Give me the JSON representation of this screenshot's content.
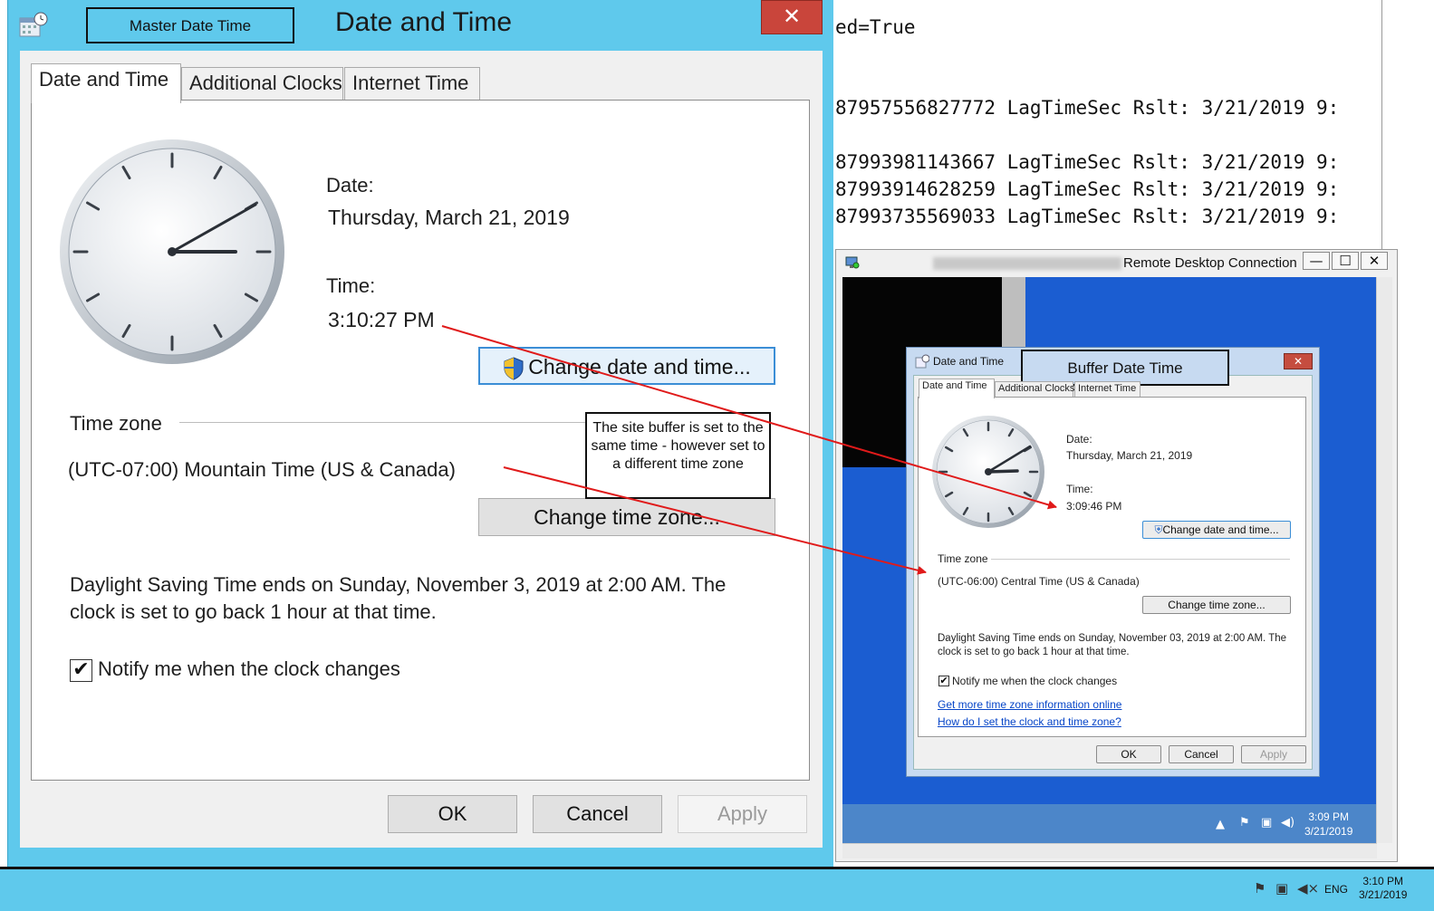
{
  "console": {
    "lines": [
      "ed=True",
      "87957556827772 LagTimeSec Rslt: 3/21/2019 9:",
      "87993981143667 LagTimeSec Rslt: 3/21/2019 9:",
      "87993914628259 LagTimeSec Rslt: 3/21/2019 9:",
      "87993735569033 LagTimeSec Rslt: 3/21/2019 9:"
    ]
  },
  "master": {
    "window_title": "Date and Time",
    "callout_label": "Master Date Time",
    "close_glyph": "✕",
    "tabs": [
      "Date and Time",
      "Additional Clocks",
      "Internet Time"
    ],
    "date_label": "Date:",
    "date_value": "Thursday, March 21, 2019",
    "time_label": "Time:",
    "time_value": "3:10:27 PM",
    "change_datetime_button": "Change date and time...",
    "timezone_heading": "Time zone",
    "timezone_value": "(UTC-07:00) Mountain Time (US & Canada)",
    "change_timezone_button": "Change time zone...",
    "dst_line1": "Daylight Saving Time ends on Sunday, November 3, 2019 at 2:00 AM. The",
    "dst_line2": "clock is set to go back 1 hour at that time.",
    "notify_checked": true,
    "notify_label": "Notify me when the clock changes",
    "ok": "OK",
    "cancel": "Cancel",
    "apply": "Apply"
  },
  "note": {
    "text": "The site buffer is set to the same time - however set to a different time zone"
  },
  "rdp": {
    "title": "Remote Desktop Connection",
    "titlebar_buttons": [
      "—",
      "☐",
      "✕"
    ],
    "tray_time": "3:09 PM",
    "tray_date": "3/21/2019"
  },
  "buffer": {
    "window_title": "Date and Time",
    "callout_label": "Buffer Date Time",
    "tabs": [
      "Date and Time",
      "Additional Clocks",
      "Internet Time"
    ],
    "date_label": "Date:",
    "date_value": "Thursday, March 21, 2019",
    "time_label": "Time:",
    "time_value": "3:09:46 PM",
    "change_datetime_button": "Change date and time...",
    "timezone_heading": "Time zone",
    "timezone_value": "(UTC-06:00) Central Time (US & Canada)",
    "change_timezone_button": "Change time zone...",
    "dst_line1": "Daylight Saving Time ends on Sunday, November 03, 2019 at 2:00 AM. The",
    "dst_line2": "clock is set to go back 1 hour at that time.",
    "notify_checked": true,
    "notify_label": "Notify me when the clock changes",
    "link1": "Get more time zone information online",
    "link2": "How do I set the clock and time zone?",
    "ok": "OK",
    "cancel": "Cancel",
    "apply": "Apply"
  },
  "taskbar": {
    "language": "ENG",
    "time": "3:10 PM",
    "date": "3/21/2019"
  },
  "colors": {
    "window_frame": "#5fc9ec",
    "close_button": "#c9453b",
    "annotation_arrow": "#e01a1a",
    "rdp_desktop": "#1b5dd1",
    "link": "#0645c8"
  }
}
